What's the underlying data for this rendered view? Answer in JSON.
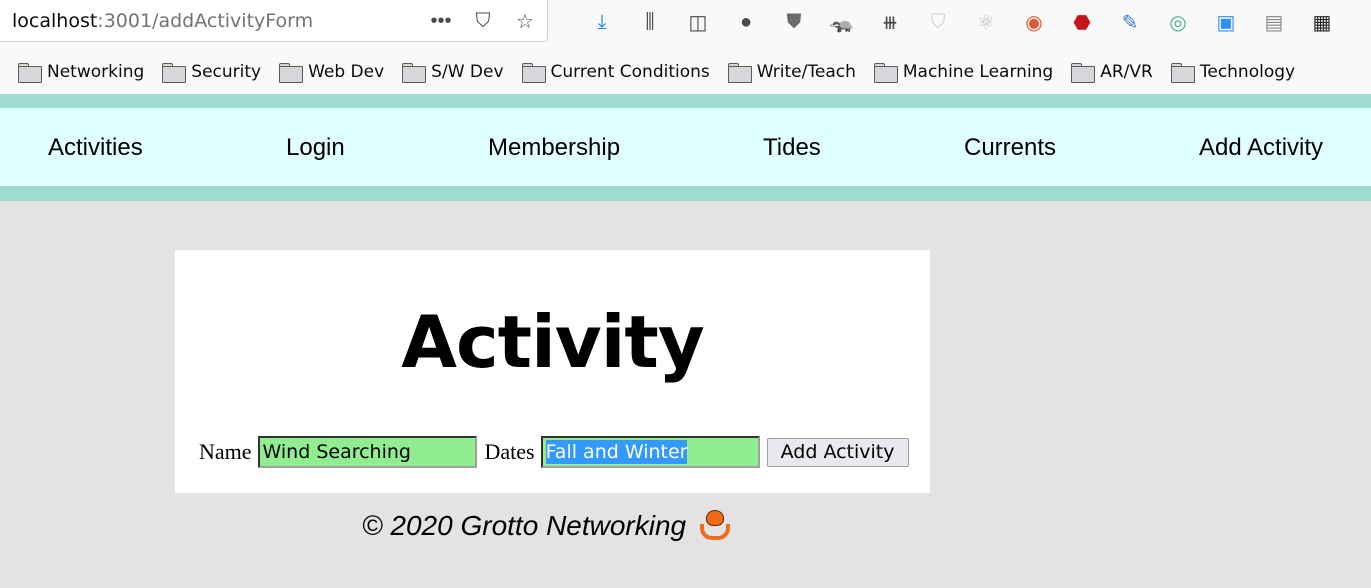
{
  "browser": {
    "url_host": "localhost",
    "url_path": ":3001/addActivityForm",
    "url_actions": [
      {
        "name": "page-actions-icon",
        "glyph": "•••"
      },
      {
        "name": "pocket-icon",
        "glyph": "⛉"
      },
      {
        "name": "bookmark-star-icon",
        "glyph": "☆"
      }
    ],
    "extensions": [
      {
        "name": "downloads-icon",
        "glyph": "⤓",
        "color": "#0a84ff"
      },
      {
        "name": "library-icon",
        "glyph": "⫼",
        "color": "#4a4a4f"
      },
      {
        "name": "sidebar-icon",
        "glyph": "◫",
        "color": "#4a4a4f"
      },
      {
        "name": "account-icon",
        "glyph": "●",
        "color": "#4a4a4f"
      },
      {
        "name": "ublock-icon",
        "glyph": "⛊",
        "color": "#6b6b6b"
      },
      {
        "name": "privacy-badger-icon",
        "glyph": "🦡",
        "color": "#e87a1a"
      },
      {
        "name": "fence-icon",
        "glyph": "⧻",
        "color": "#4a4a4f"
      },
      {
        "name": "shield-extension-icon",
        "glyph": "⛉",
        "color": "#cfcfcf"
      },
      {
        "name": "react-devtools-icon",
        "glyph": "⚛",
        "color": "#bdbdbd"
      },
      {
        "name": "duckduckgo-icon",
        "glyph": "◉",
        "color": "#de5833"
      },
      {
        "name": "cleaner-icon",
        "glyph": "⬣",
        "color": "#c4161c"
      },
      {
        "name": "eyedropper-icon",
        "glyph": "✎",
        "color": "#3a7bd5"
      },
      {
        "name": "extension-circle-icon",
        "glyph": "◎",
        "color": "#4caf8f"
      },
      {
        "name": "zoom-icon",
        "glyph": "▣",
        "color": "#2d8cff"
      },
      {
        "name": "document-icon",
        "glyph": "▤",
        "color": "#8a8a8a"
      },
      {
        "name": "apps-grid-icon",
        "glyph": "▦",
        "color": "#222222"
      }
    ],
    "bookmarks": [
      "Networking",
      "Security",
      "Web Dev",
      "S/W Dev",
      "Current Conditions",
      "Write/Teach",
      "Machine Learning",
      "AR/VR",
      "Technology"
    ]
  },
  "nav": {
    "items": [
      "Activities",
      "Login",
      "Membership",
      "Tides",
      "Currents",
      "Add Activity"
    ]
  },
  "form": {
    "title": "Activity",
    "name_label": "Name",
    "name_value": "Wind Searching",
    "dates_label": "Dates",
    "dates_value": "Fall and Winter",
    "submit_label": "Add Activity"
  },
  "footer": {
    "text": "© 2020 Grotto Networking",
    "icon": "octopus-icon"
  },
  "colors": {
    "nav_band": "#9ddbd3",
    "nav_bg": "#e0ffff",
    "page_bg": "#e3e3e3",
    "input_bg": "#90ee90",
    "selection": "#3399ff"
  }
}
